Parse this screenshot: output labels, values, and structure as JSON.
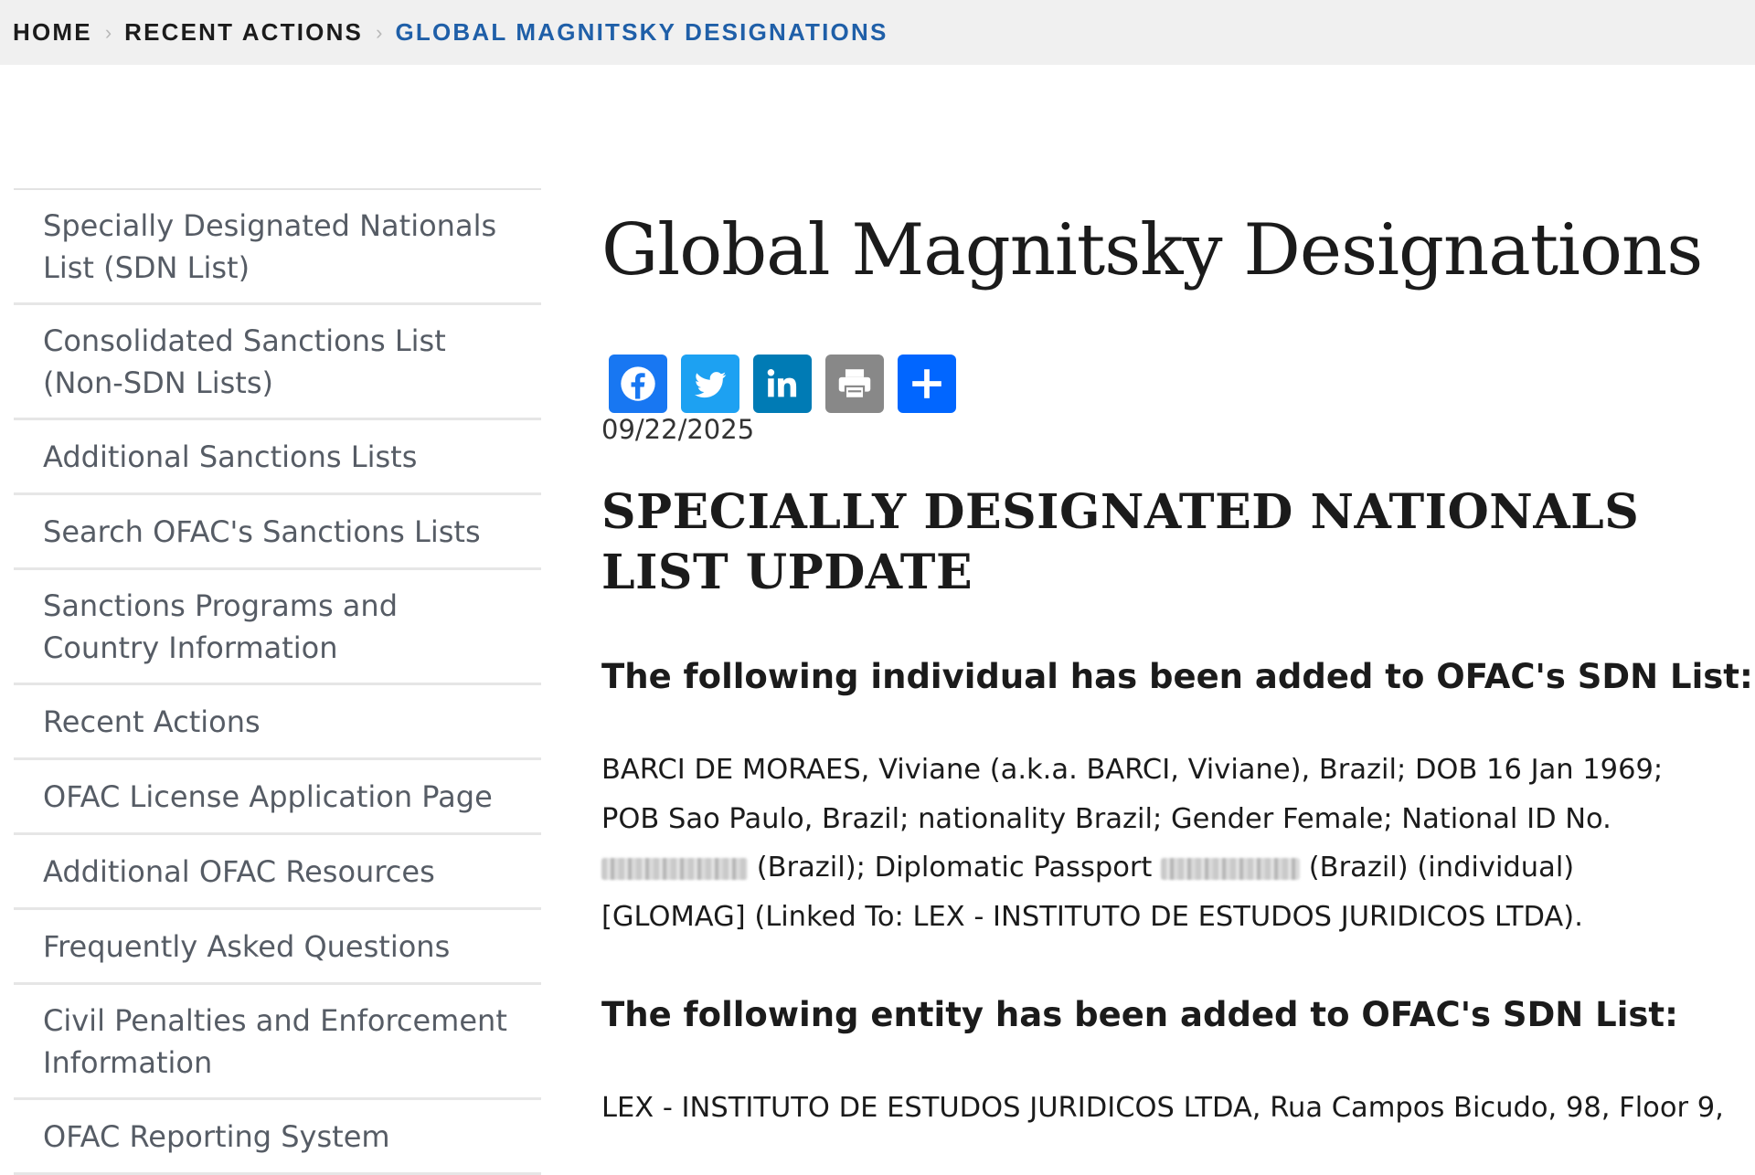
{
  "breadcrumb": {
    "items": [
      "HOME",
      "RECENT ACTIONS",
      "GLOBAL MAGNITSKY DESIGNATIONS"
    ],
    "separator": "›"
  },
  "sidebar": {
    "items": [
      {
        "label": "Specially Designated Nationals List (SDN List)"
      },
      {
        "label": "Consolidated Sanctions List (Non-SDN Lists)"
      },
      {
        "label": "Additional Sanctions Lists"
      },
      {
        "label": "Search OFAC's Sanctions Lists"
      },
      {
        "label": "Sanctions Programs and Country Information"
      },
      {
        "label": "Recent Actions"
      },
      {
        "label": "OFAC License Application Page"
      },
      {
        "label": "Additional OFAC Resources"
      },
      {
        "label": "Frequently Asked Questions"
      },
      {
        "label": "Civil Penalties and Enforcement Information"
      },
      {
        "label": "OFAC Reporting System"
      }
    ]
  },
  "main": {
    "title": "Global Magnitsky Designations",
    "share": {
      "icons": [
        "facebook-icon",
        "twitter-icon",
        "linkedin-icon",
        "print-icon",
        "share-plus-icon"
      ],
      "colors": {
        "facebook": "#1877f2",
        "twitter": "#1da1f2",
        "linkedin": "#007bb5",
        "print": "#888888",
        "share": "#0166ff"
      }
    },
    "date": "09/22/2025",
    "section_title": "SPECIALLY DESIGNATED NATIONALS LIST UPDATE",
    "individual_heading": "The following individual has been added to OFAC's SDN List:",
    "individual_entry": {
      "part1": "BARCI DE MORAES, Viviane (a.k.a. BARCI, Viviane), Brazil; DOB 16 Jan 1969; POB Sao Paulo, Brazil; nationality Brazil; Gender Female; National ID No.",
      "part2": "(Brazil); Diplomatic Passport",
      "part3": "(Brazil) (individual) [GLOMAG] (Linked To: LEX - INSTITUTO DE ESTUDOS JURIDICOS LTDA)."
    },
    "entity_heading": "The following entity has been added to OFAC's SDN List:",
    "entity_entry": "LEX - INSTITUTO DE ESTUDOS JURIDICOS LTDA, Rua Campos Bicudo, 98, Floor 9,"
  }
}
